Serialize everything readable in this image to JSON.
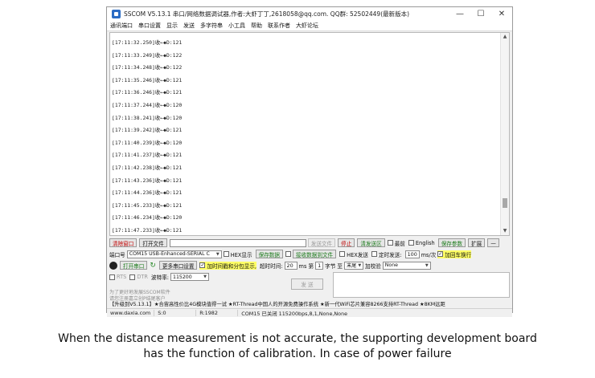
{
  "window": {
    "title": "SSCOM V5.13.1 串口/网络数据调试器,作者:大虾丁丁,2618058@qq.com. QQ群: 52502449(最新版本)",
    "controls": [
      "—",
      "☐",
      "✕"
    ]
  },
  "menu": [
    "通讯端口",
    "串口设置",
    "显示",
    "发送",
    "多字符串",
    "小工具",
    "帮助",
    "联系作者",
    "大虾论坛"
  ],
  "receive": {
    "lines": [
      "[17:11:32.250]收←◆D:121",
      "[17:11:33.249]收←◆D:122",
      "[17:11:34.248]收←◆D:122",
      "[17:11:35.246]收←◆D:121",
      "[17:11:36.246]收←◆D:121",
      "[17:11:37.244]收←◆D:120",
      "[17:11:38.241]收←◆D:120",
      "[17:11:39.242]收←◆D:121",
      "[17:11:40.239]收←◆D:120",
      "[17:11:41.237]收←◆D:121",
      "[17:11:42.238]收←◆D:121",
      "[17:11:43.236]收←◆D:121",
      "[17:11:44.236]收←◆D:121",
      "[17:11:45.233]收←◆D:121",
      "[17:11:46.234]收←◆D:120",
      "[17:11:47.233]收←◆D:121"
    ]
  },
  "toolbar": {
    "clear_window": "清除窗口",
    "open_file": "打开文件",
    "send_file": "发送文件",
    "stop": "停止",
    "clear_send": "清发送区",
    "topmost": "最前",
    "english": "English",
    "save_params": "保存参数",
    "expand": "扩展",
    "collapse": "—"
  },
  "port_row": {
    "port_label": "端口号",
    "port_value": "COM15 USB-Enhanced-SERIAL C",
    "hex_display": "HEX显示",
    "save_data": "保存数据",
    "recv_to_file": "接收数据到文件",
    "hex_send": "HEX发送",
    "timed_send": "定时发送:",
    "interval_value": "100",
    "interval_unit": "ms/次",
    "add_crlf": "加回车换行"
  },
  "open_row": {
    "open_port": "打开串口",
    "more_settings": "更多串口设置",
    "add_timestamp": "加时间戳和分包显示,",
    "timeout_label": "超时时间:",
    "timeout_value": "20",
    "timeout_unit": "ms 第",
    "byte_value": "1",
    "byte_label": "字节 至",
    "end_value": "末尾",
    "checksum_label": "加校验",
    "checksum_value": "None"
  },
  "line_row": {
    "rts": "RTS",
    "dtr": "DTR",
    "baud_label": "波特率:",
    "baud_value": "115200"
  },
  "promo": {
    "line1": "为了更好地发展SSCOM软件",
    "line2": "请您注册嘉立创P结尾客户"
  },
  "send_button": "发 送",
  "marquee": "【升级到V5.13.1】★合宙高性价比4G模块值得一试 ★RT-Thread中国人的开源免费操作系统 ★新一代WiFi芯片兼容8266支持RT-Thread ★8KM远距",
  "status": {
    "website": "www.daxia.com",
    "s": "S:0",
    "r": "R:1982",
    "port_state": "COM15 已关闭  115200bps,8,1,None,None"
  },
  "caption": {
    "line1": "When the distance measurement is not accurate, the supporting development board",
    "line2": "has the function of calibration. In case of power failure"
  }
}
